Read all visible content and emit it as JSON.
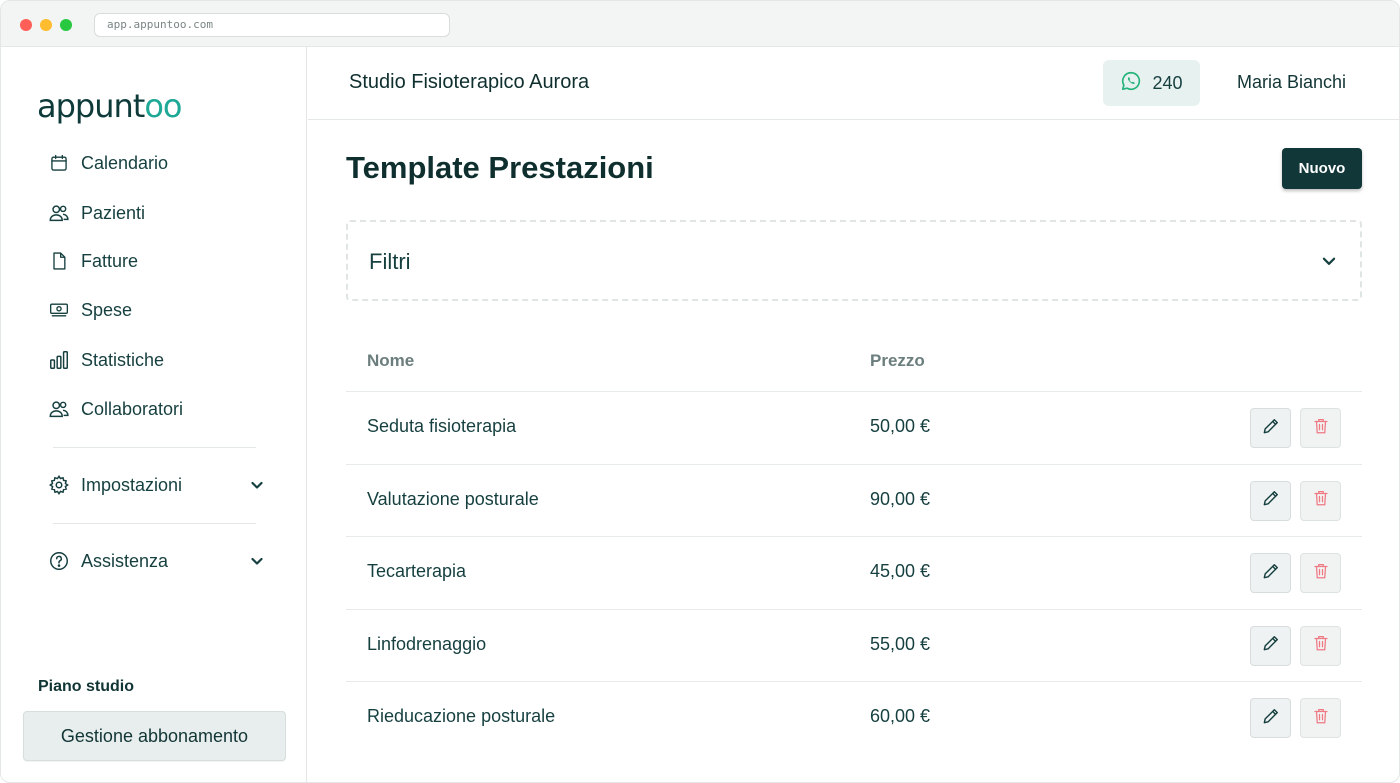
{
  "browser": {
    "url": "app.appuntoo.com"
  },
  "brand": {
    "logo_text_start": "appunt",
    "logo_text_end": "oo",
    "accent": "#1ea896",
    "dark": "#113738"
  },
  "sidebar": {
    "items": [
      {
        "label": "Calendario",
        "icon": "calendar-icon"
      },
      {
        "label": "Pazienti",
        "icon": "users-icon"
      },
      {
        "label": "Fatture",
        "icon": "document-icon"
      },
      {
        "label": "Spese",
        "icon": "money-icon"
      },
      {
        "label": "Statistiche",
        "icon": "bar-chart-icon"
      },
      {
        "label": "Collaboratori",
        "icon": "users-icon"
      }
    ],
    "settings": {
      "label": "Impostazioni",
      "icon": "gear-icon"
    },
    "help": {
      "label": "Assistenza",
      "icon": "help-circle-icon"
    },
    "plan_label": "Piano studio",
    "plan_button": "Gestione abbonamento"
  },
  "header": {
    "studio_name": "Studio Fisioterapico Aurora",
    "whatsapp_count": "240",
    "user_name": "Maria Bianchi"
  },
  "main": {
    "title": "Template Prestazioni",
    "new_button": "Nuovo",
    "filters_label": "Filtri",
    "columns": {
      "name": "Nome",
      "price": "Prezzo"
    },
    "rows": [
      {
        "name": "Seduta fisioterapia",
        "price": "50,00 €"
      },
      {
        "name": "Valutazione posturale",
        "price": "90,00 €"
      },
      {
        "name": "Tecarterapia",
        "price": "45,00 €"
      },
      {
        "name": "Linfodrenaggio",
        "price": "55,00 €"
      },
      {
        "name": "Rieducazione posturale",
        "price": "60,00 €"
      }
    ]
  }
}
